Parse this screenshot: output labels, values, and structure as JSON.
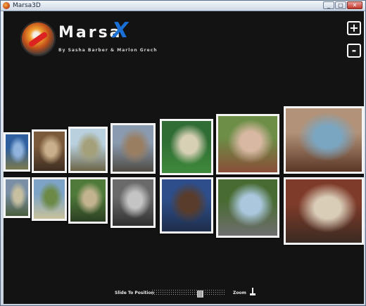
{
  "window": {
    "title": "Marsa3D",
    "controls": [
      "minimize",
      "maximize",
      "close"
    ]
  },
  "logo": {
    "word": "Marsa",
    "accent_letter": "X",
    "byline": "By Sasha Barber & Marlon Grech",
    "accent_color": "#1a6fd6"
  },
  "zoom_buttons": {
    "zoom_in": "+",
    "zoom_out": "-"
  },
  "gallery": {
    "top_row": [
      {
        "subject": "blue sky landscape",
        "colors": [
          "#2f5f9e",
          "#8fb3dd",
          "#7a7a4e"
        ]
      },
      {
        "subject": "two people smiling",
        "colors": [
          "#7a5a3a",
          "#c9b08a",
          "#3e2c20"
        ]
      },
      {
        "subject": "lake with bench",
        "colors": [
          "#b9d0df",
          "#a4a07a",
          "#6b6446"
        ]
      },
      {
        "subject": "crowd at fair",
        "colors": [
          "#8a9bb0",
          "#9a7e62",
          "#4e4a42"
        ]
      },
      {
        "subject": "baseball field",
        "colors": [
          "#2f6d34",
          "#d7d0b5",
          "#3f8a3c"
        ]
      },
      {
        "subject": "toddler outdoors",
        "colors": [
          "#6c8e46",
          "#d9b8a3",
          "#8a4e3a"
        ]
      },
      {
        "subject": "woman portrait",
        "colors": [
          "#b29278",
          "#7aa6c2",
          "#5a3626"
        ]
      }
    ],
    "bottom_row": [
      {
        "subject": "people on street",
        "colors": [
          "#7a8fa5",
          "#c7c0a0",
          "#4b5d3c"
        ]
      },
      {
        "subject": "tree in park",
        "colors": [
          "#7da4c6",
          "#6c8a46",
          "#c9c19a"
        ]
      },
      {
        "subject": "child on path",
        "colors": [
          "#4f7a3a",
          "#c3b48f",
          "#2c3e22"
        ]
      },
      {
        "subject": "group at table",
        "colors": [
          "#6a6a6a",
          "#c4c4c4",
          "#2f2f2f"
        ]
      },
      {
        "subject": "two men close-up",
        "colors": [
          "#2d4e8a",
          "#5a3c2a",
          "#1e2e4a"
        ]
      },
      {
        "subject": "street with trees",
        "colors": [
          "#486b32",
          "#aac7dd",
          "#6e6e6e"
        ]
      },
      {
        "subject": "men on bench",
        "colors": [
          "#7f3b2a",
          "#d9cdb8",
          "#3b2a22"
        ]
      }
    ]
  },
  "controls_bar": {
    "slide_label": "Slide To Position",
    "zoom_label": "Zoom",
    "slider_position": 0.68
  }
}
